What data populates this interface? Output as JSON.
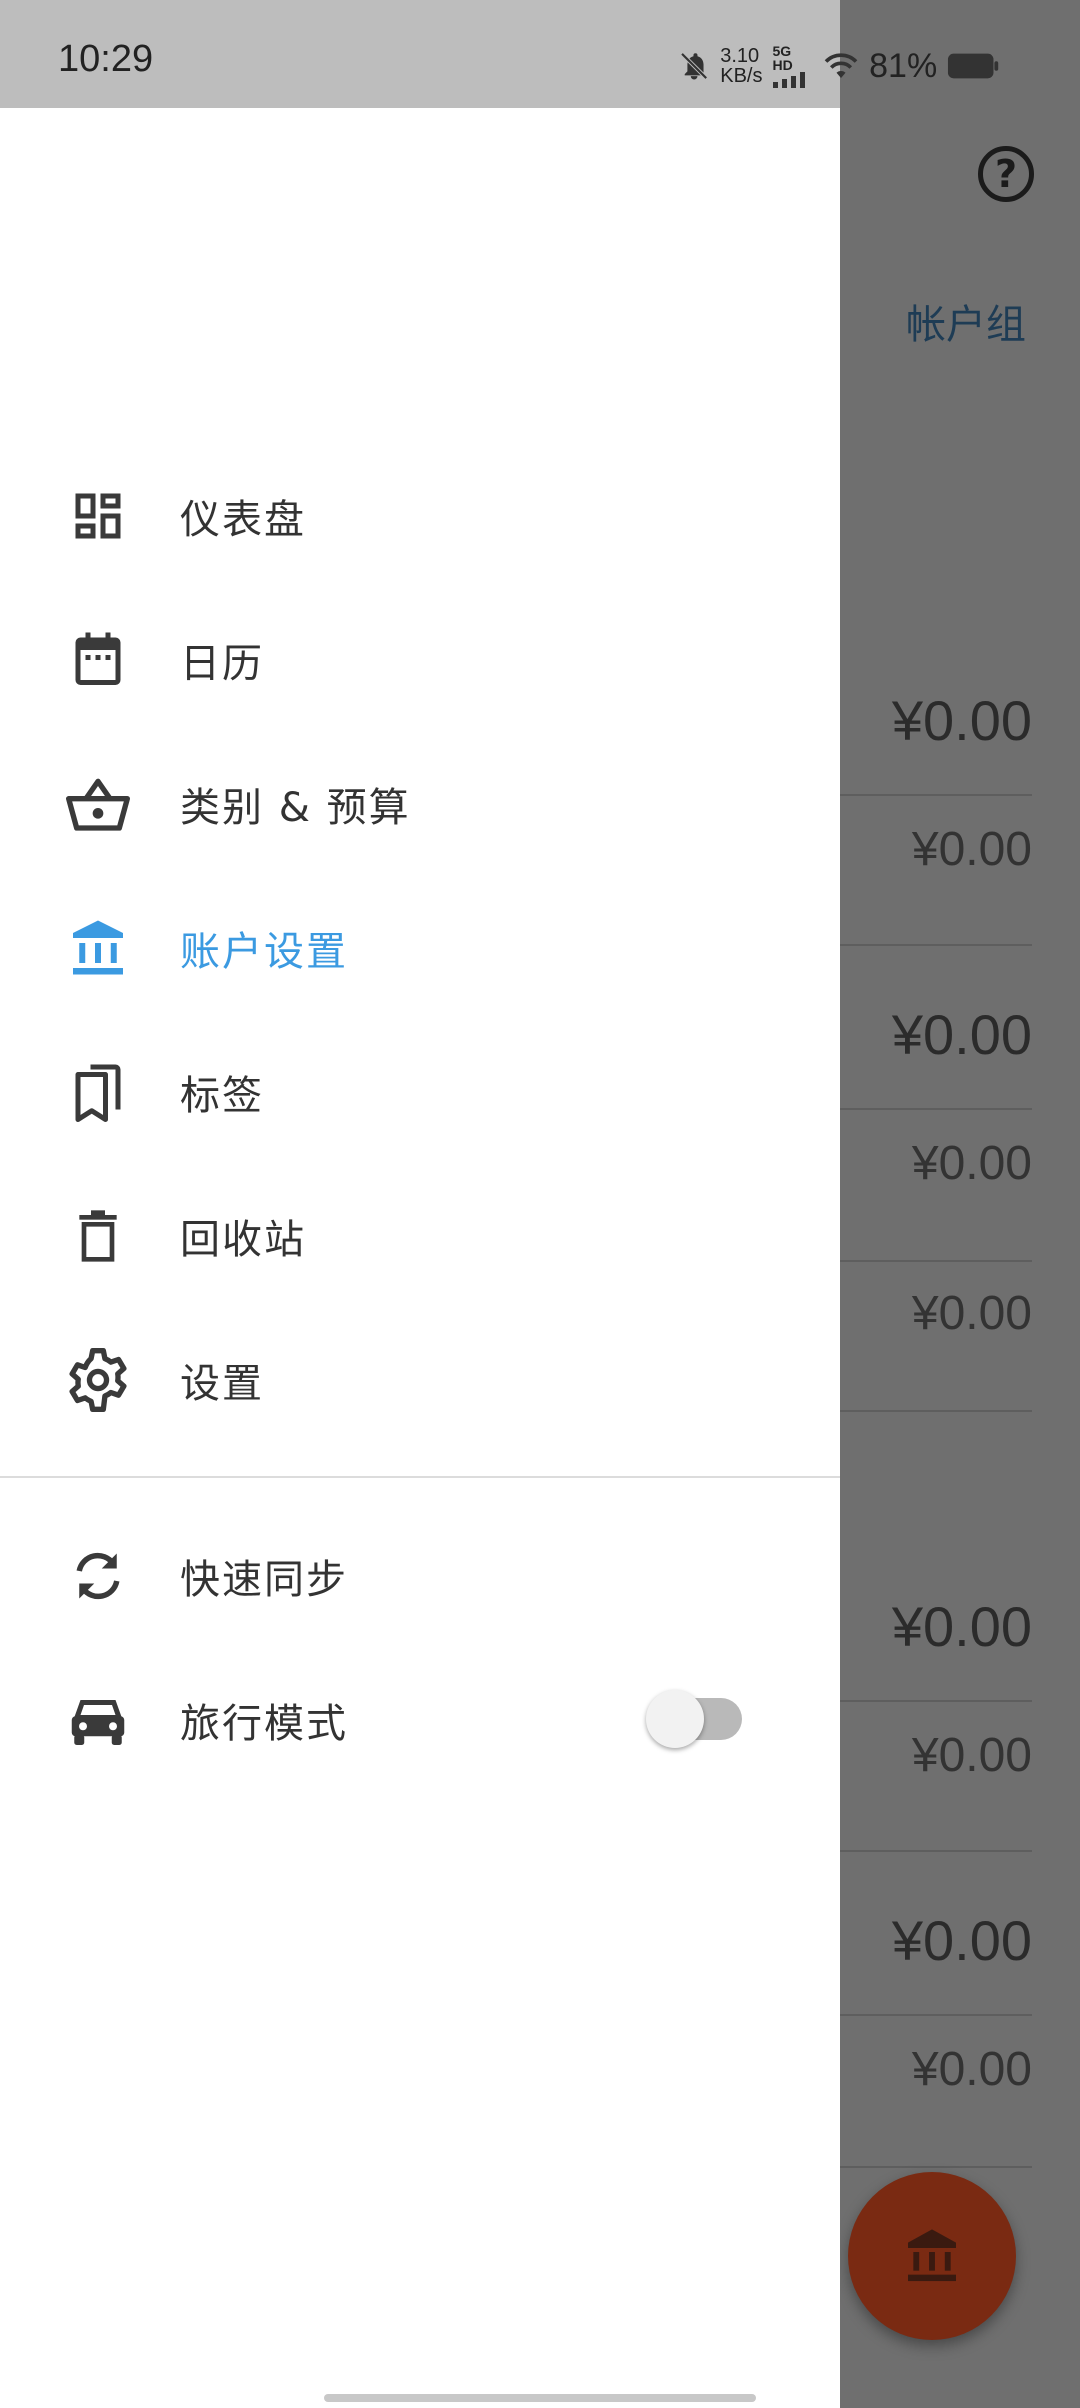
{
  "status_bar": {
    "time": "10:29",
    "speed_value": "3.10",
    "speed_unit": "KB/s",
    "network_top": "5G HD",
    "battery": "81%"
  },
  "background": {
    "tab_partial": " ",
    "tab_label": "帐户组",
    "amounts": [
      "¥0.00",
      "¥0.00",
      "¥0.00",
      "¥0.00",
      "¥0.00",
      "¥0.00",
      "¥0.00",
      "¥0.00",
      "¥0.00"
    ]
  },
  "drawer": {
    "items": [
      {
        "label": "仪表盘",
        "icon": "dashboard-icon"
      },
      {
        "label": "日历",
        "icon": "calendar-icon"
      },
      {
        "label": "类别 & 预算",
        "icon": "basket-icon"
      },
      {
        "label": "账户设置",
        "icon": "bank-icon",
        "active": true
      },
      {
        "label": "标签",
        "icon": "bookmarks-icon"
      },
      {
        "label": "回收站",
        "icon": "trash-icon"
      },
      {
        "label": "设置",
        "icon": "gear-icon"
      }
    ],
    "secondary_items": [
      {
        "label": "快速同步",
        "icon": "sync-icon"
      },
      {
        "label": "旅行模式",
        "icon": "car-icon",
        "toggle_on": false
      }
    ]
  },
  "colors": {
    "accent": "#3b9ae1",
    "icon": "#3a3a3a",
    "fab": "#7a2a12"
  }
}
